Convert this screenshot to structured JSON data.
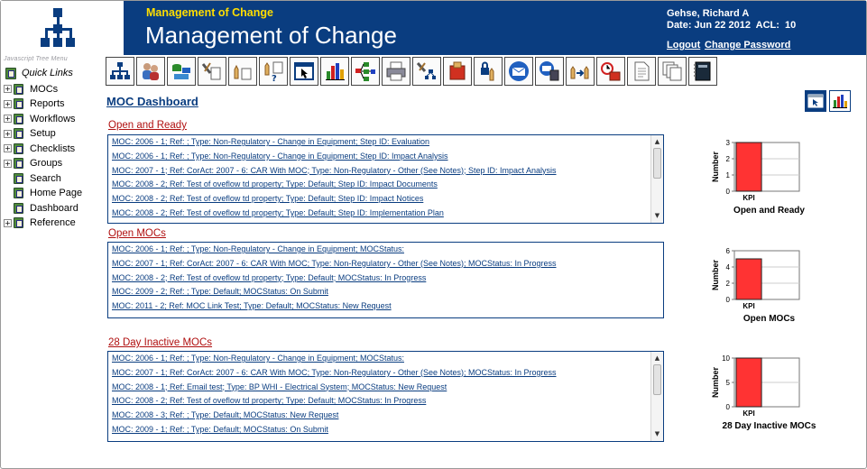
{
  "header": {
    "subtitle": "Management of Change",
    "title": "Management of Change",
    "user_name": "Gehse, Richard A",
    "user_date": "Date: Jun 22 2012  ACL:  10",
    "logout": "Logout",
    "change_password": "Change Password"
  },
  "nav": {
    "caption": "Javascript Tree Menu",
    "quick_links": "Quick Links",
    "items": [
      {
        "label": "MOCs",
        "expandable": true
      },
      {
        "label": "Reports",
        "expandable": true
      },
      {
        "label": "Workflows",
        "expandable": true
      },
      {
        "label": "Setup",
        "expandable": true
      },
      {
        "label": "Checklists",
        "expandable": true
      },
      {
        "label": "Groups",
        "expandable": true
      },
      {
        "label": "Search",
        "expandable": false
      },
      {
        "label": "Home Page",
        "expandable": false
      },
      {
        "label": "Dashboard",
        "expandable": false
      },
      {
        "label": "Reference",
        "expandable": true
      }
    ]
  },
  "toolbar": {
    "icons": [
      "org-chart-icon",
      "users-icon",
      "database-flow-icon",
      "tools-doc-icon",
      "hand-doc-icon",
      "hand-question-icon",
      "window-pointer-icon",
      "bar-chart-icon",
      "tree-diagram-icon",
      "printer-icon",
      "tools-org-icon",
      "checklist-box-icon",
      "lock-hand-icon",
      "email-icon",
      "email-doc-icon",
      "handoff-icon",
      "alarm-clock-icon",
      "document-icon",
      "documents-icon",
      "notebook-icon"
    ]
  },
  "dashboard": {
    "title": "MOC Dashboard",
    "sections": [
      {
        "title": "Open and Ready",
        "rows": [
          "MOC: 2006 - 1; Ref: ; Type: Non-Regulatory - Change in Equipment; Step ID: Evaluation",
          "MOC: 2006 - 1; Ref: ; Type: Non-Regulatory - Change in Equipment; Step ID: Impact Analysis",
          "MOC: 2007 - 1; Ref: CorAct: 2007 - 6: CAR With MOC; Type: Non-Regulatory - Other (See Notes); Step ID: Impact Analysis",
          "MOC: 2008 - 2; Ref: Test of oveflow td property; Type: Default; Step ID: Impact Documents",
          "MOC: 2008 - 2; Ref: Test of oveflow td property; Type: Default; Step ID: Impact Notices",
          "MOC: 2008 - 2; Ref: Test of oveflow td property; Type: Default; Step ID: Implementation Plan"
        ]
      },
      {
        "title": "Open MOCs",
        "rows": [
          "MOC: 2006 - 1; Ref: ; Type: Non-Regulatory - Change in Equipment; MOCStatus:",
          "MOC: 2007 - 1; Ref: CorAct: 2007 - 6: CAR With MOC; Type: Non-Regulatory - Other (See Notes); MOCStatus: In Progress",
          "MOC: 2008 - 2; Ref: Test of oveflow td property; Type: Default; MOCStatus: In Progress",
          "MOC: 2009 - 2; Ref: ; Type: Default; MOCStatus: On Submit",
          "MOC: 2011 - 2; Ref: MOC Link Test; Type: Default; MOCStatus: New Request"
        ]
      },
      {
        "title": "28 Day Inactive MOCs",
        "rows": [
          "MOC: 2006 - 1; Ref: ; Type: Non-Regulatory - Change in Equipment; MOCStatus:",
          "MOC: 2007 - 1; Ref: CorAct: 2007 - 6: CAR With MOC; Type: Non-Regulatory - Other (See Notes); MOCStatus: In Progress",
          "MOC: 2008 - 1; Ref: Email test; Type: BP WHI - Electrical System; MOCStatus: New Request",
          "MOC: 2008 - 2; Ref: Test of oveflow td property; Type: Default; MOCStatus: In Progress",
          "MOC: 2008 - 3; Ref: ; Type: Default; MOCStatus: New Request",
          "MOC: 2009 - 1; Ref: ; Type: Default; MOCStatus: On Submit"
        ]
      }
    ]
  },
  "chart_data": [
    {
      "type": "bar",
      "title": "Open and Ready",
      "ylabel": "Number",
      "categories": [
        "KPI"
      ],
      "values": [
        3
      ],
      "ylim": [
        0,
        3
      ],
      "yticks": [
        0,
        1,
        2,
        3
      ],
      "bar_color": "#ff3333"
    },
    {
      "type": "bar",
      "title": "Open MOCs",
      "ylabel": "Number",
      "categories": [
        "KPI"
      ],
      "values": [
        5
      ],
      "ylim": [
        0,
        6
      ],
      "yticks": [
        0,
        2,
        4,
        6
      ],
      "bar_color": "#ff3333"
    },
    {
      "type": "bar",
      "title": "28 Day Inactive MOCs",
      "ylabel": "Number",
      "categories": [
        "KPI"
      ],
      "values": [
        10
      ],
      "ylim": [
        0,
        10
      ],
      "yticks": [
        0,
        5,
        10
      ],
      "bar_color": "#ff3333"
    }
  ]
}
